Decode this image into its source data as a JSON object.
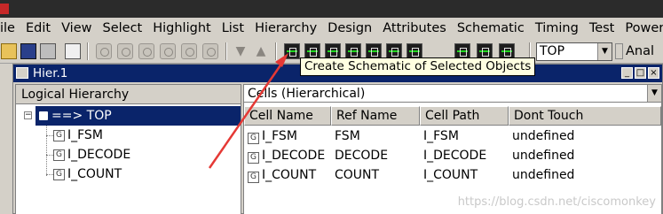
{
  "menubar": {
    "items": [
      "ile",
      "Edit",
      "View",
      "Select",
      "Highlight",
      "List",
      "Hierarchy",
      "Design",
      "Attributes",
      "Schematic",
      "Timing",
      "Test",
      "Power",
      "Anal"
    ]
  },
  "toolbar": {
    "design_combo_value": "TOP",
    "icons": [
      "folder-icon",
      "save-icon",
      "print-icon",
      "properties-icon",
      "select-icon",
      "zoom-icon",
      "schematic-icon"
    ]
  },
  "tooltip": {
    "text": "Create Schematic of Selected Objects"
  },
  "hier_window": {
    "title": "Hier.1",
    "left_panel": {
      "header": "Logical Hierarchy",
      "root": "==> TOP",
      "children": [
        "I_FSM",
        "I_DECODE",
        "I_COUNT"
      ]
    },
    "right_panel": {
      "view_selector": "Cells (Hierarchical)",
      "columns": [
        "Cell Name",
        "Ref Name",
        "Cell Path",
        "Dont Touch"
      ],
      "rows": [
        {
          "cell_name": "I_FSM",
          "ref_name": "FSM",
          "cell_path": "I_FSM",
          "dont_touch": "undefined"
        },
        {
          "cell_name": "I_DECODE",
          "ref_name": "DECODE",
          "cell_path": "I_DECODE",
          "dont_touch": "undefined"
        },
        {
          "cell_name": "I_COUNT",
          "ref_name": "COUNT",
          "cell_path": "I_COUNT",
          "dont_touch": "undefined"
        }
      ]
    }
  },
  "watermark": "https://blog.csdn.net/ciscomonkey",
  "colors": {
    "titlebar": "#0a246a",
    "selection": "#0a246a",
    "annotation_arrow": "#e53935",
    "tooltip_bg": "#ffffe1"
  }
}
